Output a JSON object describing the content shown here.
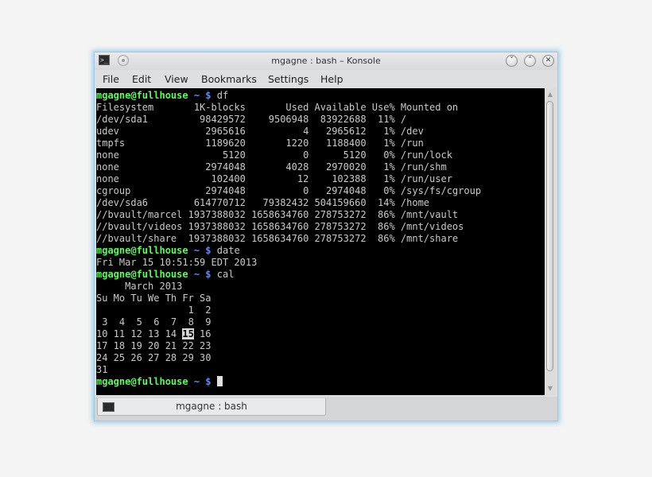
{
  "window": {
    "title": "mgagne : bash – Konsole",
    "minimize_glyph": "˅",
    "maximize_glyph": "˄",
    "close_glyph": "✕"
  },
  "menubar": {
    "items": [
      "File",
      "Edit",
      "View",
      "Bookmarks",
      "Settings",
      "Help"
    ]
  },
  "terminal": {
    "prompt_user": "mgagne@fullhouse",
    "prompt_dir": "~",
    "prompt_sign": "$",
    "commands": [
      "df",
      "date",
      "cal"
    ],
    "df_output": [
      "Filesystem       1K-blocks       Used Available Use% Mounted on",
      "/dev/sda1         98429572    9506948  83922688  11% /",
      "udev               2965616          4   2965612   1% /dev",
      "tmpfs              1189620       1220   1188400   1% /run",
      "none                  5120          0      5120   0% /run/lock",
      "none               2974048       4028   2970020   1% /run/shm",
      "none                102400         12    102388   1% /run/user",
      "cgroup             2974048          0   2974048   0% /sys/fs/cgroup",
      "/dev/sda6        614770712   79382432 504159660  14% /home",
      "//bvault/marcel 1937388032 1658634760 278753272  86% /mnt/vault",
      "//bvault/videos 1937388032 1658634760 278753272  86% /mnt/videos",
      "//bvault/share  1937388032 1658634760 278753272  86% /mnt/share"
    ],
    "date_output": "Fri Mar 15 10:51:59 EDT 2013",
    "cal": {
      "title": "     March 2013",
      "weekdays": "Su Mo Tu We Th Fr Sa",
      "week1": "                1  2",
      "week2": " 3  4  5  6  7  8  9",
      "week3_before": "10 11 12 13 14 ",
      "today": "15",
      "week3_after": " 16",
      "week4": "17 18 19 20 21 22 23",
      "week5": "24 25 26 27 28 29 30",
      "week6": "31"
    }
  },
  "tab": {
    "label": "mgagne : bash"
  },
  "scrollbar": {
    "up_glyph": "▲",
    "down_glyph": "▼"
  }
}
